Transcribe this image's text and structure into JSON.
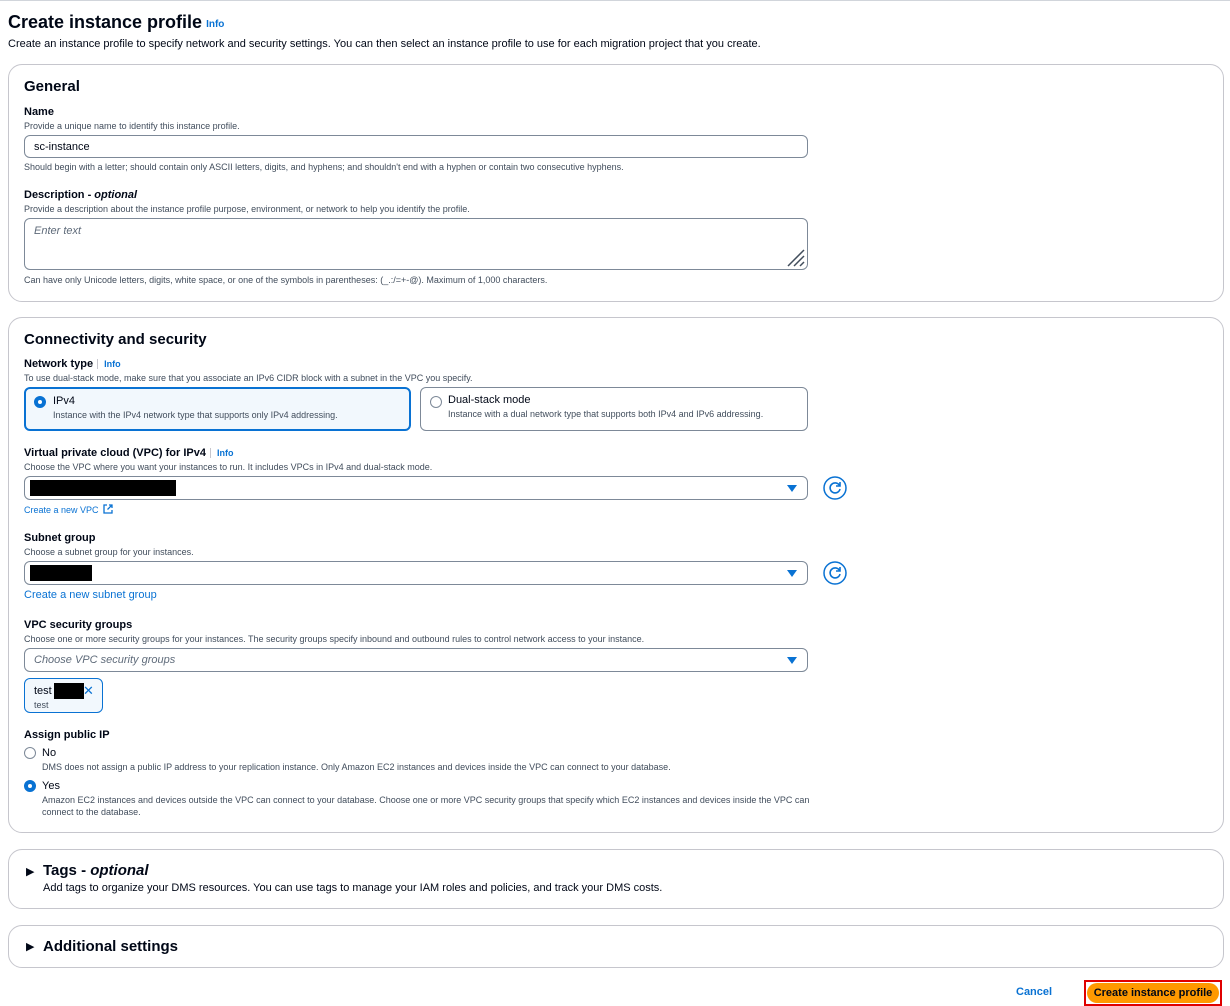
{
  "header": {
    "title": "Create instance profile",
    "info": "Info",
    "description": "Create an instance profile to specify network and security settings. You can then select an instance profile to use for each migration project that you create."
  },
  "general": {
    "title": "General",
    "name_label": "Name",
    "name_hint": "Provide a unique name to identify this instance profile.",
    "name_value": "sc-instance",
    "name_constraint": "Should begin with a letter; should contain only ASCII letters, digits, and hyphens; and shouldn't end with a hyphen or contain two consecutive hyphens.",
    "description_label": "Description - ",
    "description_optional": "optional",
    "description_hint": "Provide a description about the instance profile purpose, environment, or network to help you identify the profile.",
    "description_placeholder": "Enter text",
    "description_constraint": "Can have only Unicode letters, digits, white space, or one of the symbols in parentheses: (_.:/=+-@). Maximum of 1,000 characters."
  },
  "connectivity": {
    "title": "Connectivity and security",
    "network_type_label": "Network type",
    "network_type_info": "Info",
    "network_type_hint": "To use dual-stack mode, make sure that you associate an IPv6 CIDR block with a subnet in the VPC you specify.",
    "ipv4_title": "IPv4",
    "ipv4_desc": "Instance with the IPv4 network type that supports only IPv4 addressing.",
    "dual_title": "Dual-stack mode",
    "dual_desc": "Instance with a dual network type that supports both IPv4 and IPv6 addressing.",
    "vpc_label": "Virtual private cloud (VPC) for IPv4",
    "vpc_info": "Info",
    "vpc_hint": "Choose the VPC where you want your instances to run. It includes VPCs in IPv4 and dual-stack mode.",
    "vpc_create_link": "Create a new VPC",
    "subnet_label": "Subnet group",
    "subnet_hint": "Choose a subnet group for your instances.",
    "subnet_create_link": "Create a new subnet group",
    "sg_label": "VPC security groups",
    "sg_hint": "Choose one or more security groups for your instances. The security groups specify inbound and outbound rules to control network access to your instance.",
    "sg_placeholder": "Choose VPC security groups",
    "sg_token_label": "test",
    "sg_token_desc": "test",
    "public_ip_label": "Assign public IP",
    "no_label": "No",
    "no_desc": "DMS does not assign a public IP address to your replication instance. Only Amazon EC2 instances and devices inside the VPC can connect to your database.",
    "yes_label": "Yes",
    "yes_desc": "Amazon EC2 instances and devices outside the VPC can connect to your database. Choose one or more VPC security groups that specify which EC2 instances and devices inside the VPC can connect to the database."
  },
  "tags": {
    "title": "Tags - ",
    "optional": "optional",
    "description": "Add tags to organize your DMS resources. You can use tags to manage your IAM roles and policies, and track your DMS costs."
  },
  "additional": {
    "title": "Additional settings"
  },
  "footer": {
    "cancel": "Cancel",
    "submit": "Create instance profile"
  },
  "colors": {
    "accent": "#0972d3",
    "primary_button": "#ff9900",
    "highlight_box": "#e00000"
  }
}
